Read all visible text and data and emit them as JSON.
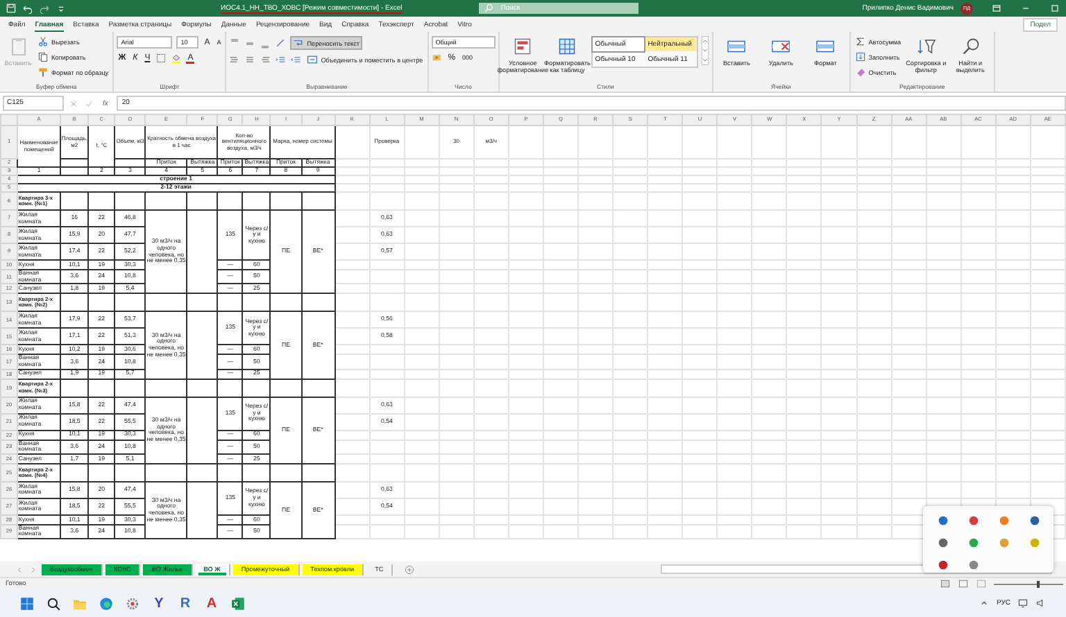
{
  "window": {
    "title": "ИОС4.1_НН_ТВО_ХОВС [Режим совместимости] - Excel",
    "search_placeholder": "Поиск",
    "user": "Прилипко Денис Вадимович",
    "avatar": "ПД"
  },
  "menu_tabs": [
    {
      "label": "Файл",
      "selected": false
    },
    {
      "label": "Главная",
      "selected": true
    },
    {
      "label": "Вставка",
      "selected": false
    },
    {
      "label": "Разметка страницы",
      "selected": false
    },
    {
      "label": "Формулы",
      "selected": false
    },
    {
      "label": "Данные",
      "selected": false
    },
    {
      "label": "Рецензирование",
      "selected": false
    },
    {
      "label": "Вид",
      "selected": false
    },
    {
      "label": "Справка",
      "selected": false
    },
    {
      "label": "Техэксперт",
      "selected": false
    },
    {
      "label": "Acrobat",
      "selected": false
    },
    {
      "label": "Vitro",
      "selected": false
    }
  ],
  "share_button": "Подел",
  "ribbon": [
    {
      "kind": "clipboard",
      "label": "Буфер обмена",
      "paste": {
        "label": "Вставить",
        "disabled": true
      },
      "cut": "Вырезать",
      "copy": "Копировать",
      "format_painter": "Формат по образцу"
    },
    {
      "kind": "font",
      "label": "Шрифт",
      "font": "Arial",
      "size": "10",
      "grow": "A",
      "shrink": "A",
      "bold": "Ж",
      "italic": "К",
      "underline": "Ч",
      "font_color": "A"
    },
    {
      "kind": "alignment",
      "label": "Выравнивание",
      "wrap": {
        "label": "Переносить текст",
        "on": true
      },
      "merge": "Объединить и поместить в центре"
    },
    {
      "kind": "number",
      "label": "Число",
      "format": "Общий",
      "percent": "%",
      "thousands": "000"
    },
    {
      "kind": "styles",
      "label": "Стили",
      "conditional": "Условное форматирование",
      "as_table": "Форматировать как таблицу",
      "styles": [
        {
          "label": "Обычный",
          "color": "#ffffff"
        },
        {
          "label": "Нейтральный",
          "color": "#ffeb9c"
        },
        {
          "label": "Обычный 10",
          "color": "#fafafa"
        },
        {
          "label": "Обычный 11",
          "color": "#f8f8f8"
        }
      ]
    },
    {
      "kind": "cells",
      "label": "Ячейки",
      "buttons": [
        "Вставить",
        "Удалить",
        "Формат"
      ]
    },
    {
      "kind": "editing",
      "label": "Редактирование",
      "autosum": "Автосумма",
      "fill": "Заполнить",
      "clear": "Очистить",
      "sort": "Сортировка и фильтр",
      "find": "Найти и выделить"
    }
  ],
  "formula_bar": {
    "name_box": "C125",
    "function_label": "fx",
    "formula": "20"
  },
  "sheet": {
    "columns": [
      "A",
      "B",
      "C",
      "D",
      "E",
      "F",
      "G",
      "H",
      "I",
      "J",
      "K",
      "L",
      "M",
      "N",
      "O",
      "P",
      "Q",
      "R",
      "S",
      "T",
      "U",
      "V",
      "W",
      "X",
      "Y",
      "Z",
      "AA",
      "AB",
      "AC",
      "AD",
      "AE"
    ],
    "head": {
      "rows": [
        "1",
        "2",
        "3"
      ],
      "name": "Наименование помещений",
      "area": "Площадь, м2",
      "temp": "t, °C",
      "volume": "Объем, м3",
      "exchange": "Кратность обмена воздуха в 1 час",
      "airflow": "Кол-во вентиляционного воздуха, м3/ч",
      "system": "Марка, номер системы",
      "sub": [
        "Приток",
        "Вытяжка",
        "Приток",
        "Вытяжка",
        "Приток",
        "Вытяжка"
      ],
      "index": [
        "1",
        "2",
        "3",
        "4",
        "5",
        "6",
        "7",
        "8",
        "9"
      ],
      "check": "Проверка",
      "rate": "30",
      "rate_unit": "м3/ч"
    },
    "sections": [
      {
        "row": "4",
        "label": "строение 1"
      },
      {
        "row": "5",
        "label": "2-12 этажи"
      }
    ],
    "apartments": [
      {
        "row": "6",
        "title": "Квартира 3-х комн. (№1)",
        "norm": "30 м3/ч на одного человека, но не менее 0,35",
        "supply": "135",
        "exhaust_note": "Через с/у и кухню",
        "supply_system": "ПЕ",
        "exhaust_system": "ВЕ*",
        "rooms": [
          {
            "row": "7",
            "kind": "living",
            "name": "Жилая комната",
            "area": "16",
            "temp": "22",
            "volume": "46,8",
            "check": "0,63"
          },
          {
            "row": "8",
            "kind": "living",
            "name": "Жилая комната",
            "area": "15,9",
            "temp": "20",
            "volume": "47,7",
            "check": "0,63"
          },
          {
            "row": "9",
            "kind": "living",
            "name": "Жилая комната",
            "area": "17,4",
            "temp": "22",
            "volume": "52,2",
            "check": "0,57"
          },
          {
            "row": "10",
            "kind": "service",
            "name": "Кухня",
            "area": "10,1",
            "temp": "19",
            "volume": "30,3",
            "supply": "—",
            "exhaust": "60"
          },
          {
            "row": "11",
            "kind": "service",
            "name": "Ванная комната",
            "area": "3,6",
            "temp": "24",
            "volume": "10,8",
            "supply": "—",
            "exhaust": "50"
          },
          {
            "row": "12",
            "kind": "service",
            "name": "Санузел",
            "area": "1,8",
            "temp": "19",
            "volume": "5,4",
            "supply": "—",
            "exhaust": "25"
          }
        ]
      },
      {
        "row": "13",
        "title": "Квартира 2-х комн. (№2)",
        "norm": "30 м3/ч на одного человека, но не менее 0,35",
        "supply": "135",
        "exhaust_note": "Через с/у и кухню",
        "supply_system": "ПЕ",
        "exhaust_system": "ВЕ*",
        "rooms": [
          {
            "row": "14",
            "kind": "living",
            "name": "Жилая комната",
            "area": "17,9",
            "temp": "22",
            "volume": "53,7",
            "check": "0,56"
          },
          {
            "row": "15",
            "kind": "living",
            "name": "Жилая комната",
            "area": "17,1",
            "temp": "22",
            "volume": "51,3",
            "check": "0,58"
          },
          {
            "row": "16",
            "kind": "service",
            "name": "Кухня",
            "area": "10,2",
            "temp": "19",
            "volume": "30,6",
            "supply": "—",
            "exhaust": "60"
          },
          {
            "row": "17",
            "kind": "service",
            "name": "Ванная комната",
            "area": "3,6",
            "temp": "24",
            "volume": "10,8",
            "supply": "—",
            "exhaust": "50"
          },
          {
            "row": "18",
            "kind": "service",
            "name": "Санузел",
            "area": "1,9",
            "temp": "19",
            "volume": "5,7",
            "supply": "—",
            "exhaust": "25"
          }
        ]
      },
      {
        "row": "19",
        "title": "Квартира 2-х комн. (№3)",
        "norm": "30 м3/ч на одного человека, но не менее 0,35",
        "supply": "135",
        "exhaust_note": "Через с/у и кухню",
        "supply_system": "ПЕ",
        "exhaust_system": "ВЕ*",
        "rooms": [
          {
            "row": "20",
            "kind": "living",
            "name": "Жилая комната",
            "area": "15,8",
            "temp": "22",
            "volume": "47,4",
            "check": "0,63"
          },
          {
            "row": "21",
            "kind": "living",
            "name": "Жилая комната",
            "area": "18,5",
            "temp": "22",
            "volume": "55,5",
            "check": "0,54"
          },
          {
            "row": "22",
            "kind": "service",
            "name": "Кухня",
            "area": "10,1",
            "temp": "19",
            "volume": "30,3",
            "supply": "—",
            "exhaust": "60"
          },
          {
            "row": "23",
            "kind": "service",
            "name": "Ванная комната",
            "area": "3,6",
            "temp": "24",
            "volume": "10,8",
            "supply": "—",
            "exhaust": "50"
          },
          {
            "row": "24",
            "kind": "service",
            "name": "Санузел",
            "area": "1,7",
            "temp": "19",
            "volume": "5,1",
            "supply": "—",
            "exhaust": "25"
          }
        ]
      },
      {
        "row": "25",
        "title": "Квартира 2-х комн. (№4)",
        "norm": "30 м3/ч на одного человека, но не менее 0,35",
        "supply": "135",
        "exhaust_note": "Через с/у и кухню",
        "supply_system": "ПЕ",
        "exhaust_system": "ВЕ*",
        "rooms": [
          {
            "row": "26",
            "kind": "living",
            "name": "Жилая комната",
            "area": "15,8",
            "temp": "20",
            "volume": "47,4",
            "check": "0,63"
          },
          {
            "row": "27",
            "kind": "living",
            "name": "Жилая комната",
            "area": "18,5",
            "temp": "22",
            "volume": "55,5",
            "check": "0,54"
          },
          {
            "row": "28",
            "kind": "service",
            "name": "Кухня",
            "area": "10,1",
            "temp": "19",
            "volume": "30,3",
            "supply": "—",
            "exhaust": "60"
          },
          {
            "row": "29",
            "kind": "service",
            "name": "Ванная комната",
            "area": "3,6",
            "temp": "24",
            "volume": "10,8",
            "supply": "—",
            "exhaust": "50"
          }
        ]
      }
    ]
  },
  "sheet_tabs": [
    {
      "label": "Воздухообмен",
      "selected": false,
      "color": "#00b050"
    },
    {
      "label": "ХОВС",
      "selected": false,
      "color": "#00b050"
    },
    {
      "label": "ВО Жилье",
      "selected": false,
      "color": "#00b050"
    },
    {
      "label": "ВО Ж",
      "selected": true,
      "color": "#00b050"
    },
    {
      "label": "Промежуточный",
      "selected": false,
      "color": "#ffff00"
    },
    {
      "label": "Техпом.кровли",
      "selected": false,
      "color": "#ffff00"
    },
    {
      "label": "ТС",
      "selected": false
    }
  ],
  "status_bar": {
    "text": "Готово",
    "zoom": {
      "level": 0.62
    }
  },
  "taskbar": {
    "apps": [
      {
        "kind": "start"
      },
      {
        "kind": "search"
      },
      {
        "kind": "folder"
      },
      {
        "kind": "browser"
      },
      {
        "kind": "tool"
      },
      {
        "kind": "letter",
        "glyph": "Y",
        "color": "#3a4aa8"
      },
      {
        "kind": "letter",
        "glyph": "R",
        "color": "#3b6fb6"
      },
      {
        "kind": "letter",
        "glyph": "A",
        "color": "#d42a2a"
      },
      {
        "kind": "excel"
      }
    ],
    "language": "РУС"
  },
  "tray_popup": {
    "icons": [
      {
        "color": "#1f6fd0"
      },
      {
        "color": "#d83b3b"
      },
      {
        "color": "#f07d1a"
      },
      {
        "color": "#2c5fa8"
      },
      {
        "color": "#666666"
      },
      {
        "color": "#2ba84a"
      },
      {
        "color": "#e0a030"
      },
      {
        "color": "#c9b400"
      },
      {
        "color": "#c0242c"
      },
      {
        "color": "#888888"
      }
    ]
  }
}
